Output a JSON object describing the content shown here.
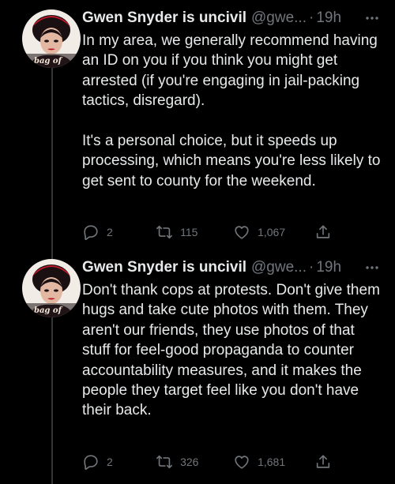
{
  "colors": {
    "background": "#000000",
    "text": "#e7e9ea",
    "secondary": "#71767b",
    "thread_line": "#333639"
  },
  "tweets": [
    {
      "author_name": "Gwen Snyder is uncivil",
      "handle": "@gwe...",
      "separator": "·",
      "time": "19h",
      "avatar_caption": "a bag of",
      "text": "In my area, we generally recommend having an ID on you if you think you might get arrested (if you're engaging in jail-packing tactics, disregard).\n\nIt's a personal choice, but it speeds up processing, which means you're less likely to get sent to county for the weekend.",
      "replies": "2",
      "retweets": "115",
      "likes": "1,067",
      "icons": [
        "reply-icon",
        "retweet-icon",
        "like-icon",
        "share-icon",
        "more-icon"
      ]
    },
    {
      "author_name": "Gwen Snyder is uncivil",
      "handle": "@gwe...",
      "separator": "·",
      "time": "19h",
      "avatar_caption": "a bag of",
      "text": "Don't thank cops at protests. Don't give them hugs and take cute photos with them. They aren't our friends, they use photos of that stuff for feel-good propaganda to counter accountability measures, and it makes the people they target feel like you don't have their back.",
      "replies": "2",
      "retweets": "326",
      "likes": "1,681",
      "icons": [
        "reply-icon",
        "retweet-icon",
        "like-icon",
        "share-icon",
        "more-icon"
      ]
    }
  ]
}
